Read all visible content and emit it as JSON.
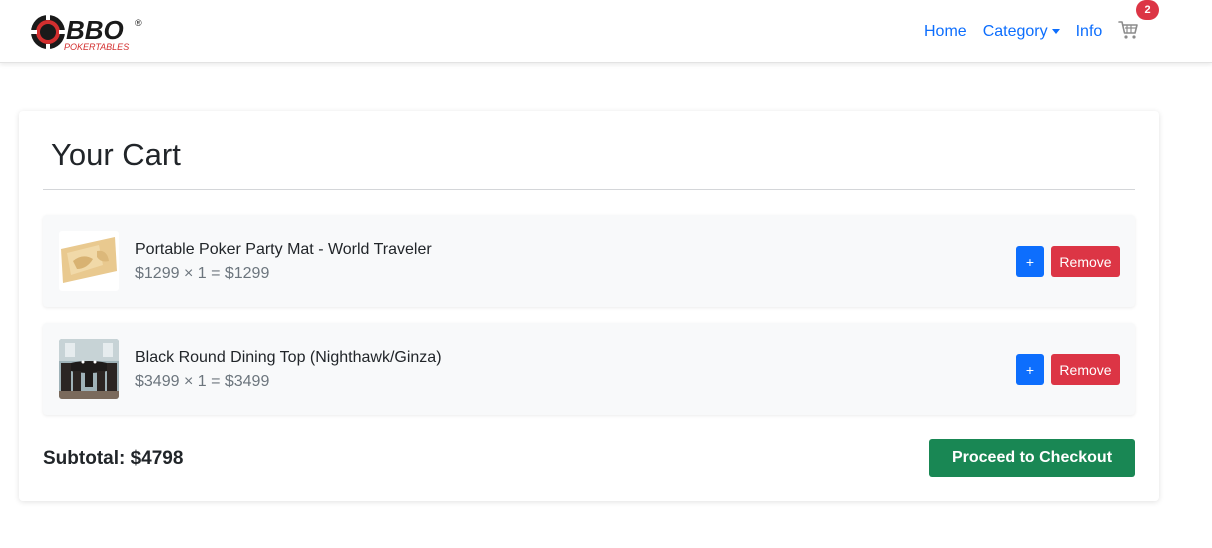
{
  "brand": {
    "logo_text": "BBO",
    "logo_subtext": "POKERTABLES",
    "registered_mark": "®"
  },
  "nav": {
    "home_label": "Home",
    "category_label": "Category",
    "info_label": "Info",
    "cart_count": "2"
  },
  "cart": {
    "title": "Your Cart",
    "items": [
      {
        "name": "Portable Poker Party Mat - World Traveler",
        "price_line": "$1299 × 1 = $1299",
        "plus_label": "+",
        "remove_label": "Remove"
      },
      {
        "name": "Black Round Dining Top (Nighthawk/Ginza)",
        "price_line": "$3499 × 1 = $3499",
        "plus_label": "+",
        "remove_label": "Remove"
      }
    ],
    "subtotal": "Subtotal: $4798",
    "checkout_label": "Proceed to Checkout"
  },
  "colors": {
    "primary": "#0d6efd",
    "danger": "#dc3545",
    "success": "#198754",
    "item_bg": "#f8f9fa"
  },
  "icons": {
    "cart": "shopping-cart-icon",
    "category_caret": "chevron-down-icon"
  }
}
